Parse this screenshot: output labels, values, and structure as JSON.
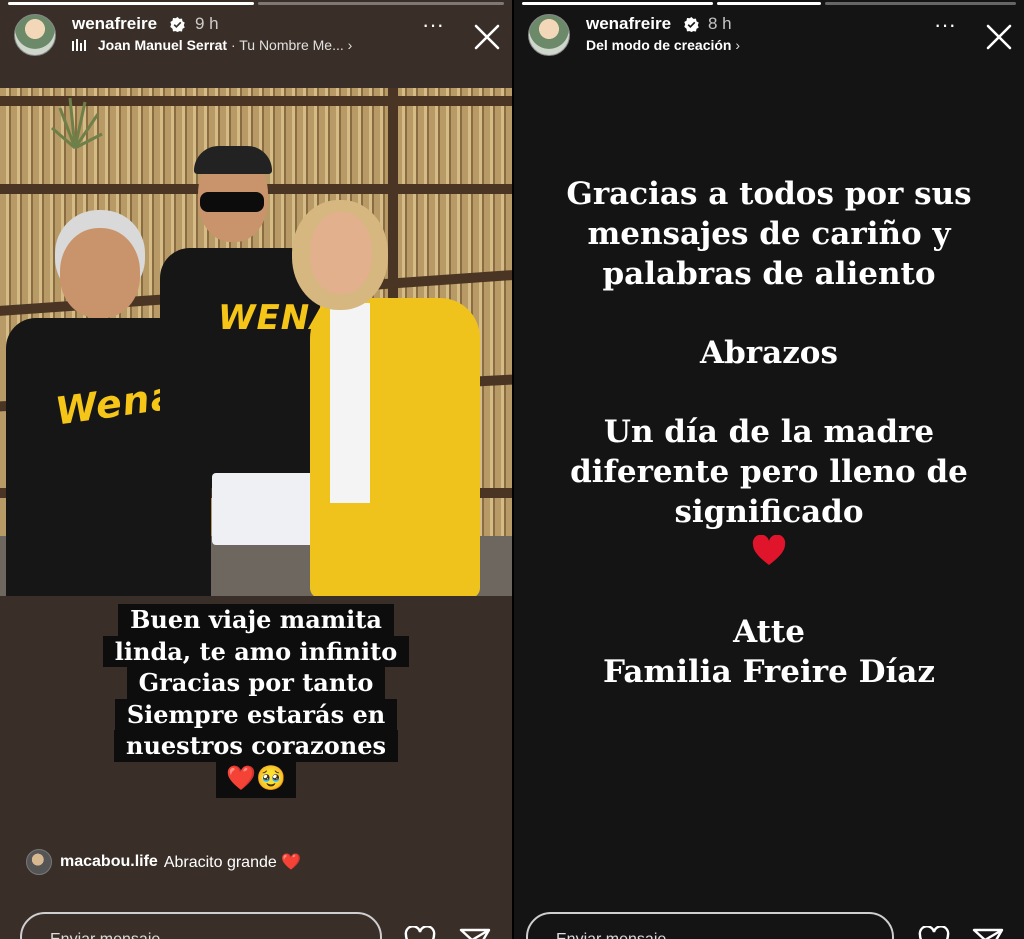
{
  "left_story": {
    "username": "wenafreire",
    "time": "9 h",
    "music_artist": "Joan Manuel Serrat",
    "music_song": "· Tu Nombre Me...",
    "caption_lines": [
      "Buen viaje mamita",
      "linda, te amo infinito",
      "Gracias por tanto",
      "Siempre estarás en",
      "nuestros corazones"
    ],
    "caption_emoji": "❤️🥹",
    "mention_user": "macabou.life",
    "mention_text": "Abracito grande ❤️",
    "composer_placeholder": "Enviar mensaje",
    "shirt_text_1": "Wena!",
    "shirt_text_2": "WENA"
  },
  "right_story": {
    "username": "wenafreire",
    "time": "8 h",
    "subtitle": "Del modo de creación",
    "text_lines": [
      "Gracias a todos por sus",
      "mensajes de cariño y",
      "palabras de aliento",
      "Abrazos",
      "Un día de la madre",
      "diferente pero lleno de",
      "significado",
      "Atte",
      "Familia Freire Díaz"
    ],
    "composer_placeholder": "Enviar mensaje"
  },
  "icons": {
    "more": "more-options-icon",
    "close": "close-icon",
    "verified": "verified-badge-icon",
    "music": "music-bars-icon",
    "heart": "heart-icon",
    "send": "send-icon"
  },
  "colors": {
    "left_background": "#3a2f28",
    "right_background": "#141414",
    "heart_red": "#e0142a",
    "verified_badge": "#ffffff"
  }
}
